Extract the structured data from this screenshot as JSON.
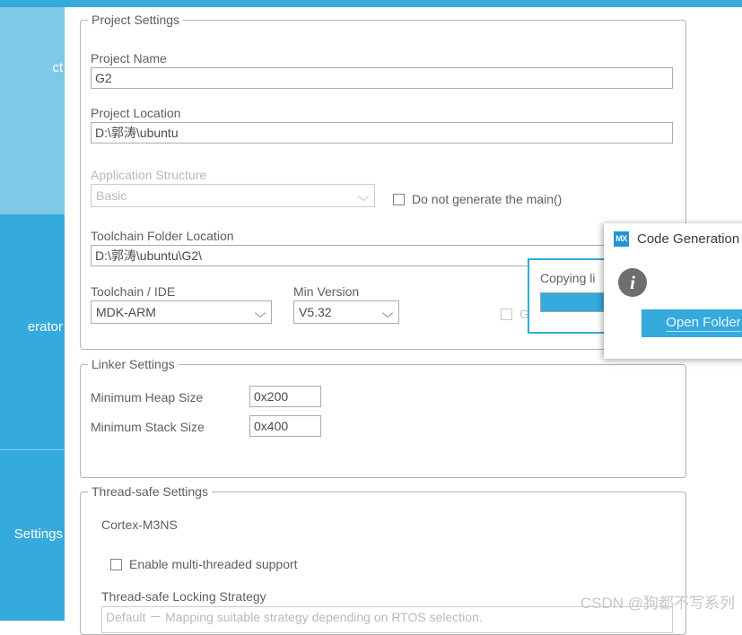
{
  "app": {
    "accent_color": "#35aadc",
    "sidebar_light_color": "#7ec8e8"
  },
  "sidebar": {
    "items": [
      {
        "label": "ct",
        "full": "Project",
        "state": "selected-light"
      },
      {
        "label": "erator",
        "full": "Code Generator",
        "state": "selected"
      },
      {
        "label": "Settings",
        "full": "Advanced Settings",
        "state": "normal"
      }
    ]
  },
  "project_settings": {
    "title": "Project Settings",
    "project_name_label": "Project Name",
    "project_name_value": "G2",
    "project_location_label": "Project Location",
    "project_location_value": "D:\\郭涛\\ubuntu",
    "application_structure_label": "Application Structure",
    "application_structure_value": "Basic",
    "do_not_generate_main_label": "Do not generate the main()",
    "toolchain_folder_label": "Toolchain Folder Location",
    "toolchain_folder_value": "D:\\郭涛\\ubuntu\\G2\\",
    "toolchain_ide_label": "Toolchain / IDE",
    "toolchain_ide_value": "MDK-ARM",
    "min_version_label": "Min Version",
    "min_version_value": "V5.32",
    "generate_under_root_label": "Ger"
  },
  "linker_settings": {
    "title": "Linker Settings",
    "min_heap_label": "Minimum Heap Size",
    "min_heap_value": "0x200",
    "min_stack_label": "Minimum Stack Size",
    "min_stack_value": "0x400"
  },
  "thread_safe_settings": {
    "title": "Thread-safe Settings",
    "core_label": "Cortex-M3NS",
    "enable_multithread_label": "Enable multi-threaded support",
    "locking_strategy_label": "Thread-safe Locking Strategy",
    "locking_strategy_value": "Default － Mapping suitable strategy depending on RTOS selection."
  },
  "progress_dialog": {
    "status_text": "Copying li",
    "progress_percent": 100
  },
  "codegen_dialog": {
    "icon_label": "MX",
    "title": "Code Generation",
    "info_glyph": "i",
    "open_folder_label": "Open Folder"
  },
  "watermark": {
    "text": "CSDN @狗都不写系列"
  }
}
